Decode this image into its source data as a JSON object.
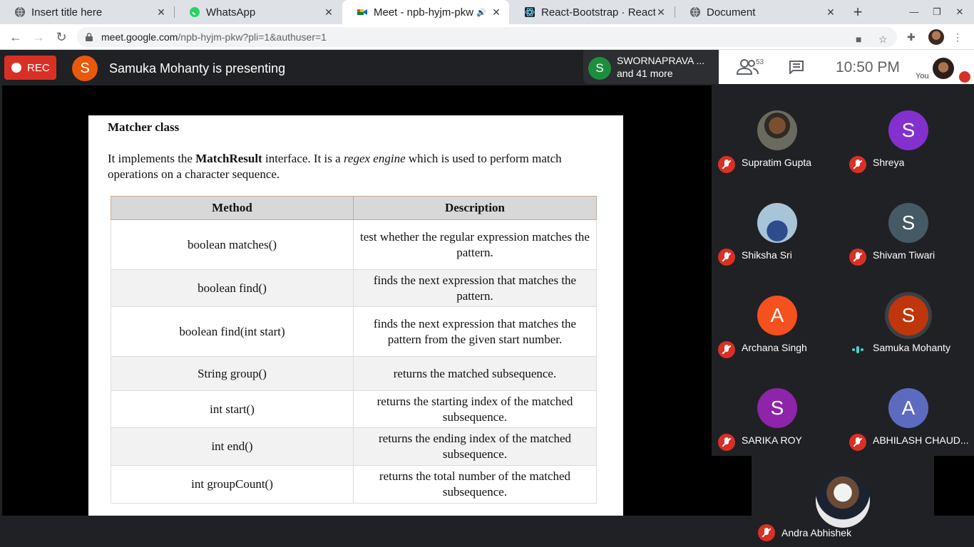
{
  "browser": {
    "tabs": [
      {
        "title": "Insert title here",
        "icon": "globe-icon"
      },
      {
        "title": "WhatsApp",
        "icon": "whatsapp-icon"
      },
      {
        "title": "Meet - npb-hyjm-pkw",
        "icon": "meet-icon",
        "active": true,
        "audio": true
      },
      {
        "title": "React-Bootstrap · React-B",
        "icon": "react-bootstrap-icon"
      },
      {
        "title": "Document",
        "icon": "globe-icon"
      }
    ],
    "url_host": "meet.google.com",
    "url_rest": "/npb-hyjm-pkw?pli=1&authuser=1"
  },
  "meet": {
    "rec_label": "REC",
    "presenter_initial": "S",
    "presenting_text": "Samuka Mohanty is presenting",
    "chip_initial": "S",
    "chip_name": "SWORNAPRAVA ...",
    "chip_more": "and 41 more",
    "people_count": "53",
    "time": "10:50 PM",
    "you_label": "You"
  },
  "slide": {
    "title": "Matcher class",
    "intro_pre": "It implements the ",
    "intro_bold": "MatchResult",
    "intro_mid": " interface. It is a ",
    "intro_italic": "regex engine",
    "intro_post": " which is used to perform match operations on a character sequence.",
    "headers": [
      "Method",
      "Description"
    ],
    "rows": [
      {
        "method": "boolean matches()",
        "description": "test whether the regular expression matches the pattern."
      },
      {
        "method": "boolean find()",
        "description": "finds the next expression that matches the pattern."
      },
      {
        "method": "boolean find(int start)",
        "description": "finds the next expression that matches the pattern from the given start number."
      },
      {
        "method": "String group()",
        "description": "returns the matched subsequence."
      },
      {
        "method": "int start()",
        "description": "returns the starting index of the matched subsequence."
      },
      {
        "method": "int end()",
        "description": "returns the ending index of the matched subsequence."
      },
      {
        "method": "int groupCount()",
        "description": "returns the total number of the matched subsequence."
      }
    ]
  },
  "participants": [
    {
      "name": "Supratim Gupta",
      "initial": "",
      "color": "",
      "muted": true
    },
    {
      "name": "Shreya",
      "initial": "S",
      "color": "#8430ce",
      "muted": true
    },
    {
      "name": "Shiksha Sri",
      "initial": "",
      "color": "",
      "muted": true
    },
    {
      "name": "Shivam Tiwari",
      "initial": "S",
      "color": "#455a64",
      "muted": true
    },
    {
      "name": "Archana Singh",
      "initial": "A",
      "color": "#f4511e",
      "muted": true
    },
    {
      "name": "Samuka Mohanty",
      "initial": "S",
      "color": "#bf360c",
      "muted": false
    },
    {
      "name": "SARIKA ROY",
      "initial": "S",
      "color": "#8e24aa",
      "muted": true
    },
    {
      "name": "ABHILASH CHAUD...",
      "initial": "A",
      "color": "#5c6bc0",
      "muted": true
    }
  ],
  "lone_participant": {
    "name": "Andra Abhishek",
    "muted": true
  },
  "colors": {
    "rec": "#d93025",
    "meet_bg": "#202124",
    "mic_off": "#d93025",
    "speaking": "#4fd1c5"
  }
}
